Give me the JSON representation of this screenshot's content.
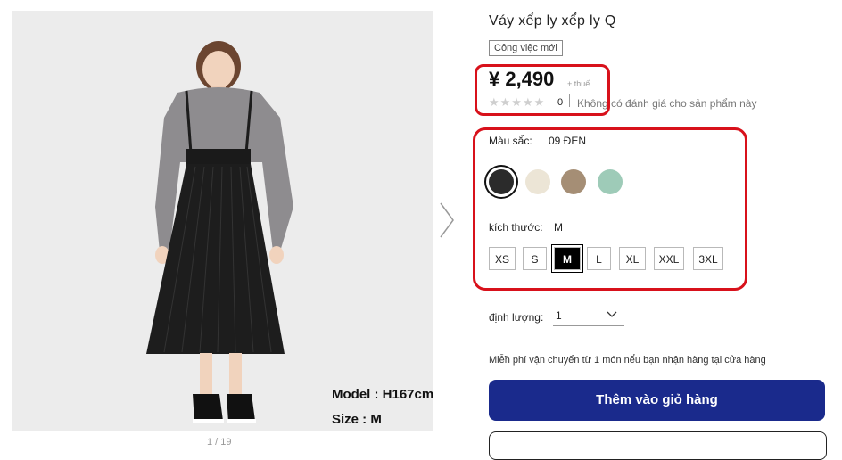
{
  "image": {
    "caption_model": "Model : H167cm",
    "caption_size": "Size : M",
    "pager": "1 / 19"
  },
  "product": {
    "title": "Váy xế́p ly xế́p ly Q",
    "badge": "Công việc mới",
    "price": "¥ 2,490",
    "tax": "+ thuế",
    "stars": "★★★★★",
    "review_count": "0",
    "review_text": "Không có đánh giá cho sản phẩm này"
  },
  "color": {
    "label": "Màu sắ́c:",
    "value": "09 ĐEN",
    "swatches": [
      {
        "name": "black",
        "hex": "#2b2b2b",
        "selected": true
      },
      {
        "name": "cream",
        "hex": "#ece5d6",
        "selected": false
      },
      {
        "name": "brown",
        "hex": "#a58e75",
        "selected": false
      },
      {
        "name": "mint",
        "hex": "#9ecbb8",
        "selected": false
      }
    ]
  },
  "size": {
    "label": "kích thước:",
    "value": "M",
    "options": [
      "XS",
      "S",
      "M",
      "L",
      "XL",
      "XXL",
      "3XL"
    ],
    "selected": "M"
  },
  "quantity": {
    "label": "định lượng:",
    "value": "1"
  },
  "shipping_note": "Miễ̃n phí vận chuyển từ 1 món nế́u bạn nhận hàng tại cửa hàng",
  "cart_button": "Thêm vào giỏ hàng",
  "colors": {
    "accent_red": "#d8111b",
    "cart_blue": "#1a2a8c"
  }
}
